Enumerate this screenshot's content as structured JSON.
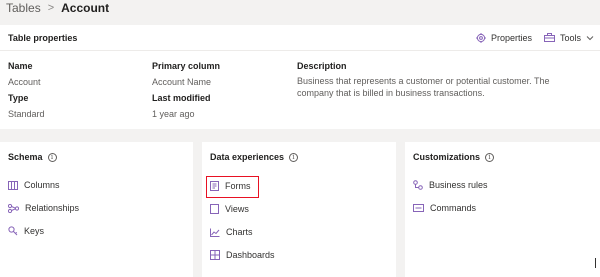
{
  "breadcrumb": {
    "root": "Tables",
    "separator": ">",
    "current": "Account"
  },
  "table_properties": {
    "title": "Table properties",
    "toolbar": {
      "properties_label": "Properties",
      "properties_icon": "gear-icon",
      "tools_label": "Tools",
      "tools_icon": "toolbox-icon",
      "chevron_icon": "chevron-down-icon"
    },
    "fields": {
      "name_label": "Name",
      "name_value": "Account",
      "type_label": "Type",
      "type_value": "Standard",
      "primary_label": "Primary column",
      "primary_value": "Account Name",
      "modified_label": "Last modified",
      "modified_value": "1 year ago",
      "description_label": "Description",
      "description_value": "Business that represents a customer or potential customer. The company that is billed in business transactions."
    }
  },
  "schema": {
    "title": "Schema",
    "items": [
      {
        "label": "Columns",
        "icon": "columns-icon"
      },
      {
        "label": "Relationships",
        "icon": "relationships-icon"
      },
      {
        "label": "Keys",
        "icon": "keys-icon"
      }
    ]
  },
  "data_experiences": {
    "title": "Data experiences",
    "items": [
      {
        "label": "Forms",
        "icon": "forms-icon",
        "highlighted": true
      },
      {
        "label": "Views",
        "icon": "views-icon"
      },
      {
        "label": "Charts",
        "icon": "charts-icon"
      },
      {
        "label": "Dashboards",
        "icon": "dashboards-icon"
      }
    ]
  },
  "customizations": {
    "title": "Customizations",
    "items": [
      {
        "label": "Business rules",
        "icon": "business-rules-icon"
      },
      {
        "label": "Commands",
        "icon": "commands-icon"
      }
    ]
  },
  "colors": {
    "accent": "#8764b8",
    "highlight": "#e81123",
    "panel": "#ffffff",
    "background": "#f3f2f1"
  }
}
